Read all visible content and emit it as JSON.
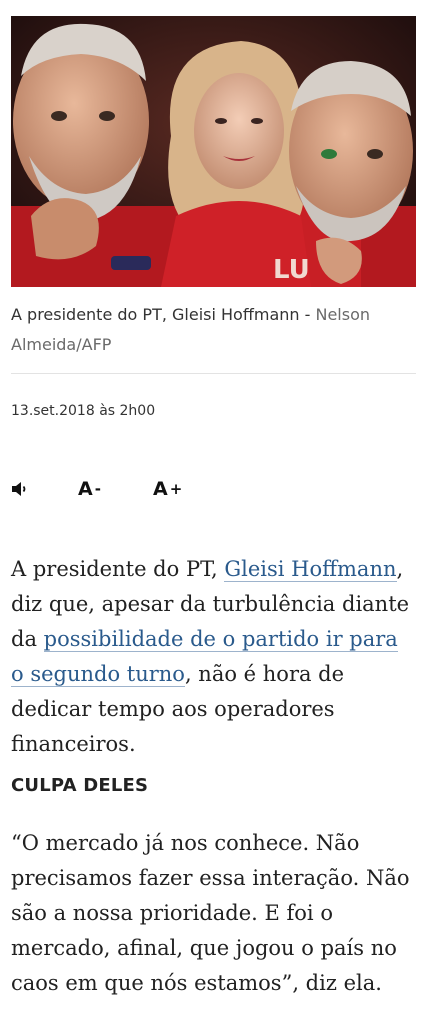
{
  "photo": {
    "alt": "A presidente do PT, Gleisi Hoffmann"
  },
  "caption": {
    "text": "A presidente do PT, Gleisi Hoffmann - ",
    "credit": "Nelson Almeida/AFP"
  },
  "dateline": "13.set.2018 às 2h00",
  "tools": {
    "audio_icon": "speaker-icon",
    "font_decrease": "A",
    "font_decrease_symbol": "-",
    "font_increase": "A",
    "font_increase_symbol": "+"
  },
  "article": {
    "p1_a": "A presidente do PT, ",
    "p1_link1": "Gleisi Hoffmann",
    "p1_b": ", diz que, apesar da turbulência diante da ",
    "p1_link2": "possibilidade de o partido ir para o segundo turno",
    "p1_c": ", não é hora de dedicar tempo aos operadores financeiros.",
    "subhead": "CULPA DELES",
    "p2": "“O mercado já nos conhece. Não precisamos fazer essa interação. Não são a nossa prioridade. E foi o mercado, afinal, que jogou o país no caos em que nós estamos”, diz ela."
  },
  "colors": {
    "link": "#2a5a8c",
    "text": "#212121",
    "credit": "#6a6a6a"
  }
}
